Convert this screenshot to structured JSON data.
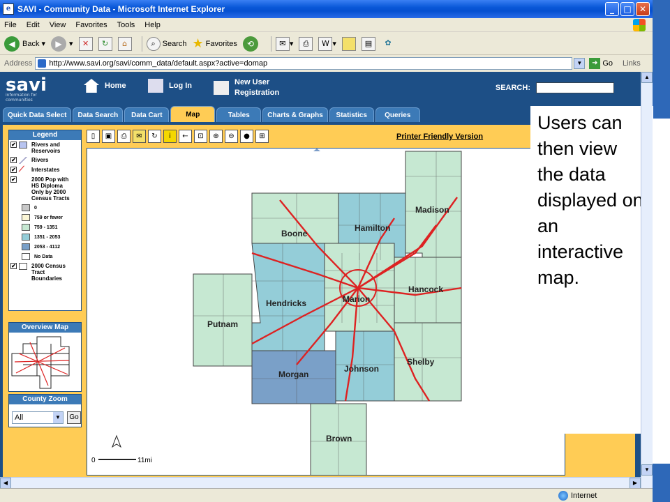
{
  "window": {
    "title": "SAVI - Community Data - Microsoft Internet Explorer"
  },
  "menu": [
    "File",
    "Edit",
    "View",
    "Favorites",
    "Tools",
    "Help"
  ],
  "toolbar": {
    "back": "Back",
    "search": "Search",
    "favorites": "Favorites"
  },
  "address": {
    "label": "Address",
    "url": "http://www.savi.org/savi/comm_data/default.aspx?active=domap",
    "go": "Go",
    "links": "Links"
  },
  "site": {
    "logo": "savi",
    "tagline": "information for communities",
    "nav": [
      "Home",
      "Log In",
      "New User Registration"
    ],
    "search_label": "SEARCH:"
  },
  "tabs": [
    "Quick Data Select",
    "Data Search",
    "Data Cart",
    "Map",
    "Tables",
    "Charts & Graphs",
    "Statistics",
    "Queries"
  ],
  "active_tab": "Map",
  "legend": {
    "title": "Legend",
    "layers": [
      {
        "label": "Rivers and Reservoirs",
        "checked": true
      },
      {
        "label": "Rivers",
        "checked": true
      },
      {
        "label": "Interstates",
        "checked": true
      },
      {
        "label": "2000 Pop with HS Diploma Only by 2000 Census Tracts",
        "checked": true
      }
    ],
    "classes": [
      {
        "label": "0",
        "color": "#c8c8c8"
      },
      {
        "label": "759 or fewer",
        "color": "#fbf6d6"
      },
      {
        "label": "759 - 1351",
        "color": "#c6e8d2"
      },
      {
        "label": "1351 - 2053",
        "color": "#94cdd8"
      },
      {
        "label": "2053 - 4112",
        "color": "#7aa0c8"
      },
      {
        "label": "No Data",
        "color": "#ffffff"
      }
    ],
    "boundary": {
      "label": "2000 Census Tract Boundaries",
      "checked": true
    }
  },
  "overview": {
    "title": "Overview Map"
  },
  "county_zoom": {
    "title": "County Zoom",
    "selected": "All",
    "go": "Go"
  },
  "map": {
    "printer_link": "Printer Friendly Version",
    "counties": [
      "Madison",
      "Boone",
      "Hamilton",
      "Hancock",
      "Hendricks",
      "Marion",
      "Putnam",
      "Shelby",
      "Johnson",
      "Morgan",
      "Brown"
    ],
    "scale_left": "0",
    "scale_right": "11mi"
  },
  "callout": "Users can then view the data displayed on an interactive map.",
  "status": {
    "zone": "Internet"
  }
}
